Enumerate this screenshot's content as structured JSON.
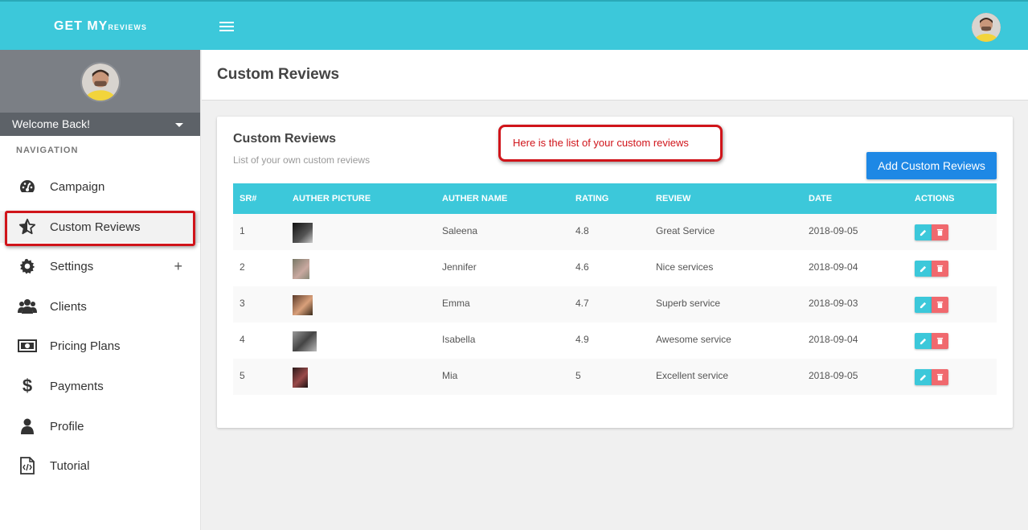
{
  "brand": {
    "main": "GET MY",
    "small": "REVIEWS"
  },
  "sidebar": {
    "welcome": "Welcome Back!",
    "nav_header": "NAVIGATION",
    "items": [
      {
        "label": "Campaign",
        "icon": "dashboard-icon"
      },
      {
        "label": "Custom Reviews",
        "icon": "star-icon"
      },
      {
        "label": "Settings",
        "icon": "gear-icon",
        "expand": "+"
      },
      {
        "label": "Clients",
        "icon": "users-icon"
      },
      {
        "label": "Pricing Plans",
        "icon": "money-icon"
      },
      {
        "label": "Payments",
        "icon": "dollar-icon"
      },
      {
        "label": "Profile",
        "icon": "user-icon"
      },
      {
        "label": "Tutorial",
        "icon": "code-file-icon"
      }
    ]
  },
  "page": {
    "title": "Custom Reviews"
  },
  "card": {
    "title": "Custom Reviews",
    "subtitle": "List of your own custom reviews",
    "callout": "Here is the list of your custom reviews",
    "add_button": "Add Custom Reviews"
  },
  "table": {
    "headers": [
      "SR#",
      "AUTHER PICTURE",
      "AUTHER NAME",
      "RATING",
      "REVIEW",
      "DATE",
      "ACTIONS"
    ],
    "rows": [
      {
        "sr": "1",
        "name": "Saleena",
        "rating": "4.8",
        "review": "Great Service",
        "date": "2018-09-05"
      },
      {
        "sr": "2",
        "name": "Jennifer",
        "rating": "4.6",
        "review": "Nice services",
        "date": "2018-09-04"
      },
      {
        "sr": "3",
        "name": "Emma",
        "rating": "4.7",
        "review": "Superb service",
        "date": "2018-09-03"
      },
      {
        "sr": "4",
        "name": "Isabella",
        "rating": "4.9",
        "review": "Awesome service",
        "date": "2018-09-04"
      },
      {
        "sr": "5",
        "name": "Mia",
        "rating": "5",
        "review": "Excellent service",
        "date": "2018-09-05"
      }
    ]
  },
  "colors": {
    "primary": "#3cc8da",
    "button": "#1e88e5",
    "delete": "#f0696e",
    "highlight": "#d0141a"
  }
}
